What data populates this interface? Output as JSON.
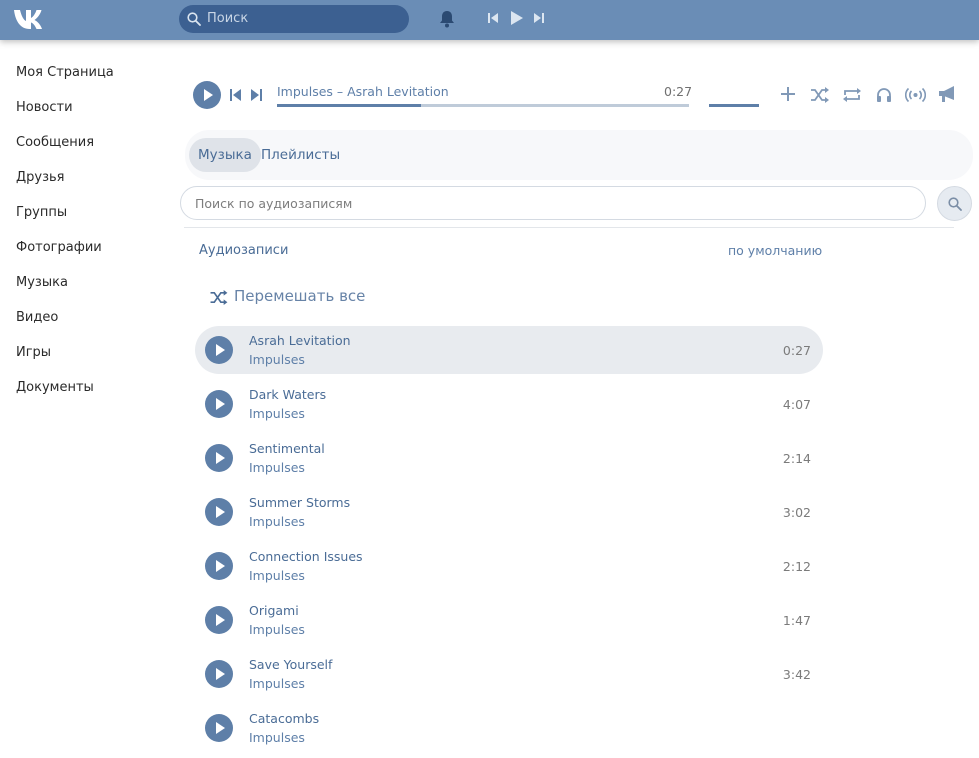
{
  "topbar": {
    "logo": "vk-logo",
    "search_placeholder": "Поиск"
  },
  "sidebar": {
    "items": [
      {
        "label": "Моя Страница"
      },
      {
        "label": "Новости"
      },
      {
        "label": "Сообщения"
      },
      {
        "label": "Друзья"
      },
      {
        "label": "Группы"
      },
      {
        "label": "Фотографии"
      },
      {
        "label": "Музыка"
      },
      {
        "label": "Видео"
      },
      {
        "label": "Игры"
      },
      {
        "label": "Документы"
      }
    ]
  },
  "player": {
    "title": "Impulses – Asrah Levitation",
    "time": "0:27",
    "progress": 0.35,
    "volume": 1.0
  },
  "tabs": [
    {
      "label": "Музыка",
      "active": true
    },
    {
      "label": "Плейлисты",
      "active": false
    }
  ],
  "audio_search": {
    "placeholder": "Поиск по аудиозаписям"
  },
  "list": {
    "heading": "Аудиозаписи",
    "sort_label": "по умолчанию",
    "shuffle_label": "Перемешать все",
    "tracks": [
      {
        "title": "Asrah Levitation",
        "artist": "Impulses",
        "duration": "0:27",
        "active": true
      },
      {
        "title": "Dark Waters",
        "artist": "Impulses",
        "duration": "4:07"
      },
      {
        "title": "Sentimental",
        "artist": "Impulses",
        "duration": "2:14"
      },
      {
        "title": "Summer Storms",
        "artist": "Impulses",
        "duration": "3:02"
      },
      {
        "title": "Connection Issues",
        "artist": "Impulses",
        "duration": "2:12"
      },
      {
        "title": "Origami",
        "artist": "Impulses",
        "duration": "1:47"
      },
      {
        "title": "Save Yourself",
        "artist": "Impulses",
        "duration": "3:42"
      },
      {
        "title": "Catacombs",
        "artist": "Impulses",
        "duration": ""
      }
    ]
  },
  "colors": {
    "topbar": "#6a8db6",
    "accent": "#5e7fa8",
    "link": "#4a6c96"
  }
}
